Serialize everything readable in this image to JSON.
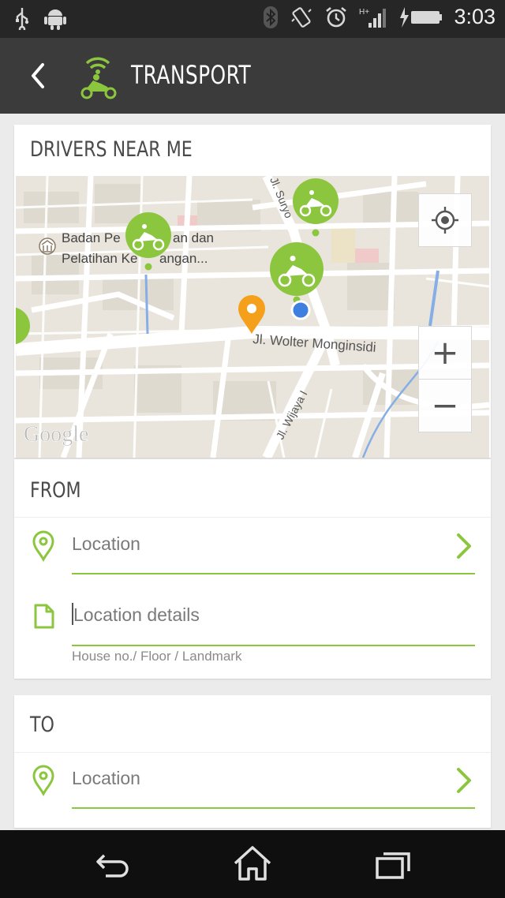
{
  "status_bar": {
    "time": "3:03"
  },
  "app_bar": {
    "title": "TRANSPORT"
  },
  "drivers_card": {
    "title": "DRIVERS NEAR ME"
  },
  "map": {
    "street_main": "Jl. Wolter Monginsidi",
    "street_suryo": "Jl. Suryo",
    "street_wijaya": "Jl. Wijaya I",
    "poi_line1": "Badan Pe",
    "poi_line1_b": "an dan",
    "poi_line2": "Pelatihan Ke",
    "poi_line2_b": "angan...",
    "provider": "Google",
    "zoom_in": "+",
    "zoom_out": "−"
  },
  "from_card": {
    "title": "FROM",
    "location_placeholder": "Location",
    "details_placeholder": "Location details",
    "details_hint": "House no./ Floor / Landmark"
  },
  "to_card": {
    "title": "TO",
    "location_placeholder": "Location"
  },
  "colors": {
    "accent": "#8cc63f",
    "pin": "#f5a01a",
    "me": "#3f7fe0"
  }
}
